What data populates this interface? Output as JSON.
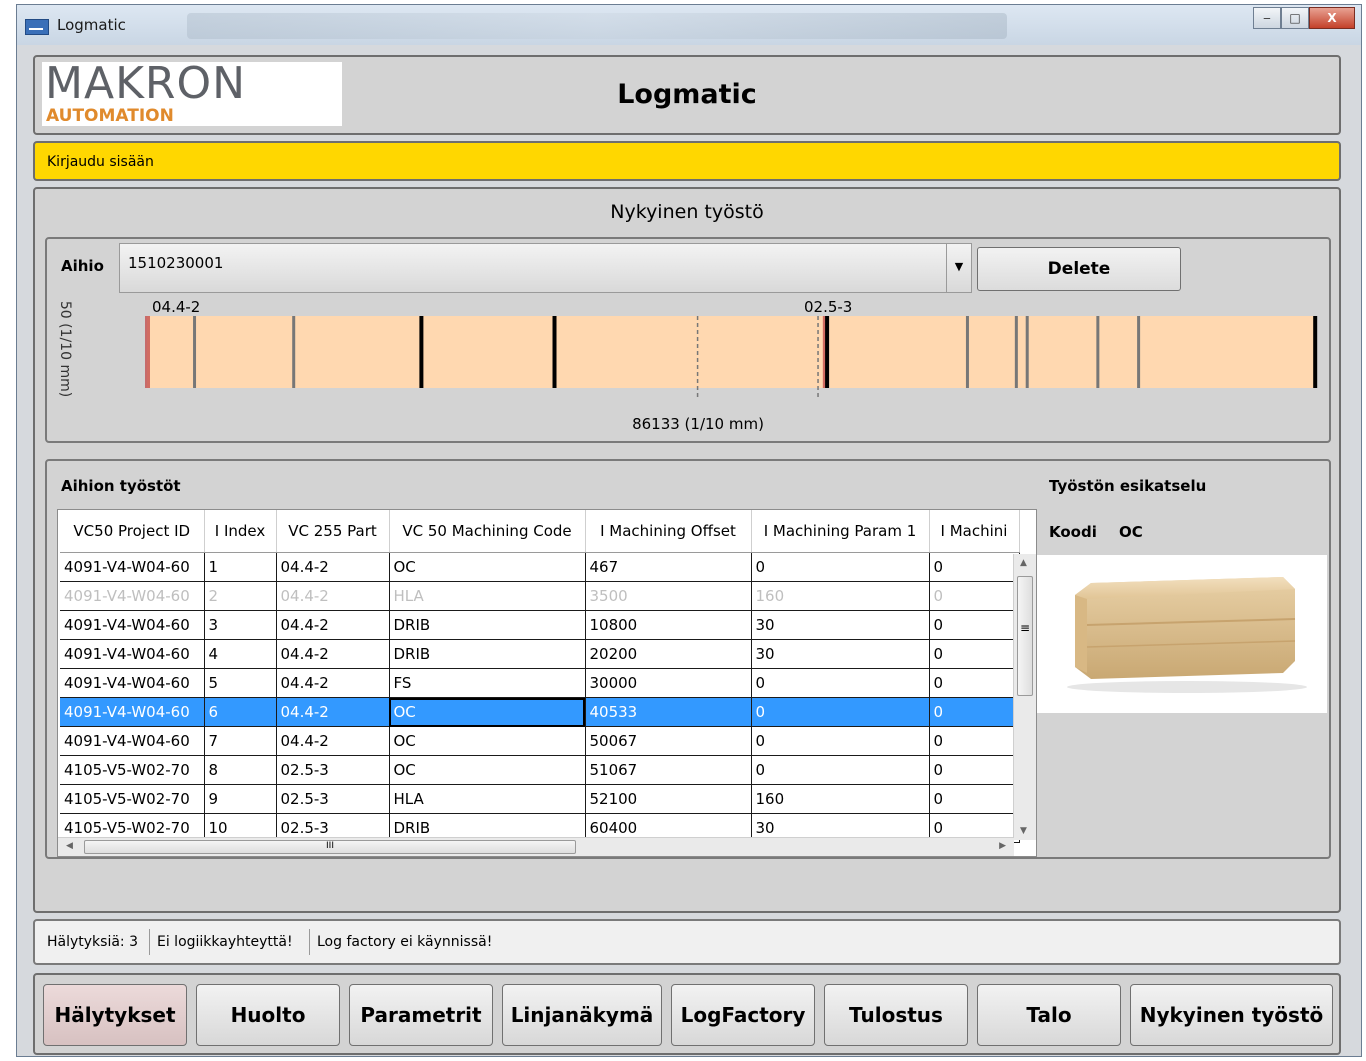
{
  "window": {
    "title": "Logmatic",
    "controls": {
      "minimize": "‒",
      "maximize": "□",
      "close": "X"
    }
  },
  "header": {
    "logo_main": "MAKRON",
    "logo_sub": "AUTOMATION",
    "title": "Logmatic"
  },
  "login_bar": {
    "text": "Kirjaudu sisään"
  },
  "current": {
    "title": "Nykyinen työstö",
    "blank_label": "Aihio",
    "blank_value": "1510230001",
    "delete_label": "Delete",
    "part_labels": [
      "04.4-2",
      "02.5-3"
    ],
    "length_label": "86133 (1/10 mm)",
    "side_label": "50 (1/10 mm)"
  },
  "log_bar": {
    "length": 86133,
    "fill_color": "#ffd8b0",
    "mark_color": "#c24848",
    "solid_marks": [
      {
        "pos": 3500,
        "weight": "thin"
      },
      {
        "pos": 10800,
        "weight": "thin"
      },
      {
        "pos": 20200,
        "weight": "thick"
      },
      {
        "pos": 30000,
        "weight": "thick"
      },
      {
        "pos": 50067,
        "weight": "thick"
      },
      {
        "pos": 60400,
        "weight": "thin"
      },
      {
        "pos": 64000,
        "weight": "thin"
      },
      {
        "pos": 64800,
        "weight": "thin"
      },
      {
        "pos": 70000,
        "weight": "thin"
      },
      {
        "pos": 73000,
        "weight": "thin"
      },
      {
        "pos": 86000,
        "weight": "thick"
      }
    ],
    "dashed_marks": [
      40533,
      49400
    ]
  },
  "operations": {
    "title": "Aihion työstöt",
    "columns": [
      "VC50 Project ID",
      "I Index",
      "VC 255 Part",
      "VC 50 Machining Code",
      "I Machining Offset",
      "I Machining Param 1",
      "I Machini"
    ],
    "rows": [
      [
        "4091-V4-W04-60",
        "1",
        "04.4-2",
        "OC",
        "467",
        "0",
        "0"
      ],
      [
        "4091-V4-W04-60",
        "2",
        "04.4-2",
        "HLA",
        "3500",
        "160",
        "0"
      ],
      [
        "4091-V4-W04-60",
        "3",
        "04.4-2",
        "DRIB",
        "10800",
        "30",
        "0"
      ],
      [
        "4091-V4-W04-60",
        "4",
        "04.4-2",
        "DRIB",
        "20200",
        "30",
        "0"
      ],
      [
        "4091-V4-W04-60",
        "5",
        "04.4-2",
        "FS",
        "30000",
        "0",
        "0"
      ],
      [
        "4091-V4-W04-60",
        "6",
        "04.4-2",
        "OC",
        "40533",
        "0",
        "0"
      ],
      [
        "4091-V4-W04-60",
        "7",
        "04.4-2",
        "OC",
        "50067",
        "0",
        "0"
      ],
      [
        "4105-V5-W02-70",
        "8",
        "02.5-3",
        "OC",
        "51067",
        "0",
        "0"
      ],
      [
        "4105-V5-W02-70",
        "9",
        "02.5-3",
        "HLA",
        "52100",
        "160",
        "0"
      ],
      [
        "4105-V5-W02-70",
        "10",
        "02.5-3",
        "DRIB",
        "60400",
        "30",
        "0"
      ]
    ],
    "disabled_row": 2,
    "selected_row": 6,
    "scroll_thumb_glyph": "III",
    "vscroll_grip": "≡"
  },
  "preview": {
    "title": "Työstön esikatselu",
    "code_label": "Koodi",
    "code_value": "OC",
    "image_icon": "log-preview-icon"
  },
  "status": {
    "alarms": "Hälytyksiä: 3",
    "conn": "Ei logiikkayhteyttä!",
    "factory": "Log factory ei käynnissä!"
  },
  "nav": {
    "buttons": [
      "Hälytykset",
      "Huolto",
      "Parametrit",
      "Linjanäkymä",
      "LogFactory",
      "Tulostus",
      "Talo",
      "Nykyinen työstö"
    ]
  },
  "colors": {
    "login_bar": "#ffd700",
    "selection": "#3399ff",
    "logo_accent": "#e08a2c"
  }
}
